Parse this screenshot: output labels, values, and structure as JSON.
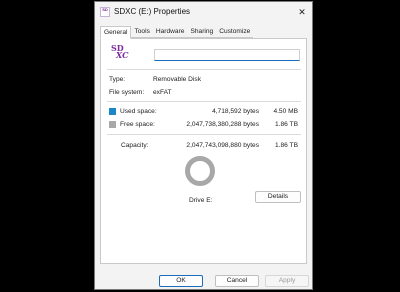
{
  "window": {
    "title": "SDXC (E:) Properties"
  },
  "tabs": [
    "General",
    "Tools",
    "Hardware",
    "Sharing",
    "Customize"
  ],
  "drive": {
    "icon_text_1": "SD",
    "icon_text_2": "XC",
    "name_value": ""
  },
  "info": {
    "type_label": "Type:",
    "type_value": "Removable Disk",
    "fs_label": "File system:",
    "fs_value": "exFAT"
  },
  "space": {
    "used_label": "Used space:",
    "used_bytes": "4,718,592 bytes",
    "used_size": "4.50 MB",
    "free_label": "Free space:",
    "free_bytes": "2,047,738,380,288 bytes",
    "free_size": "1.86 TB",
    "capacity_label": "Capacity:",
    "capacity_bytes": "2,047,743,098,880 bytes",
    "capacity_size": "1.86 TB",
    "used_fraction": 2.3e-06
  },
  "drive_label": "Drive E:",
  "buttons": {
    "details": "Details",
    "ok": "OK",
    "cancel": "Cancel",
    "apply": "Apply"
  },
  "colors": {
    "used": "#1b86c8",
    "free": "#a8a8a8",
    "accent": "#1b6bb8"
  }
}
